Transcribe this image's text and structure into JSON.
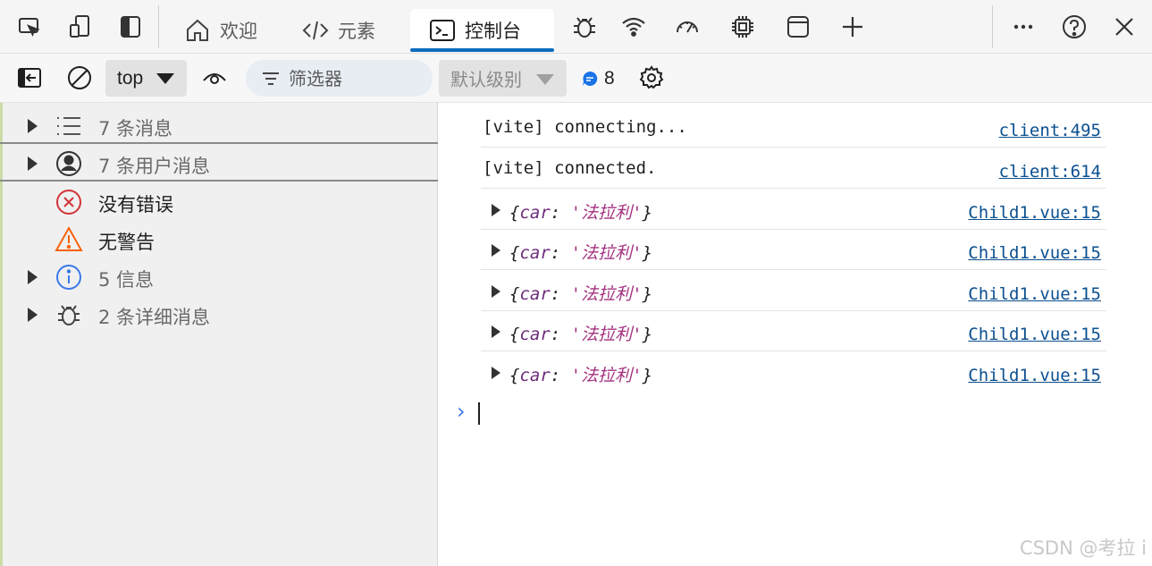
{
  "tabbar": {
    "tabs": [
      {
        "label": "欢迎",
        "icon": "home-icon"
      },
      {
        "label": "元素",
        "icon": "code-icon"
      },
      {
        "label": "控制台",
        "icon": "console-icon",
        "active": true
      }
    ],
    "icons": [
      "device-inspect-icon",
      "device-emulation-icon",
      "dock-sidebar-icon",
      "bug-icon",
      "wifi-icon",
      "performance-gauge-icon",
      "cpu-chip-icon",
      "application-window-icon",
      "plus-icon",
      "more-icon",
      "help-icon",
      "close-icon"
    ]
  },
  "toolbar": {
    "context": "top",
    "filter_placeholder": "筛选器",
    "level": "默认级别",
    "issue_count": "8"
  },
  "sidebar": {
    "items": [
      {
        "label": "7 条消息",
        "icon": "list-icon",
        "expandable": true
      },
      {
        "label": "7 条用户消息",
        "icon": "user-circle-icon",
        "expandable": true
      },
      {
        "label": "没有错误",
        "icon": "error-icon",
        "expandable": false
      },
      {
        "label": "无警告",
        "icon": "warning-icon",
        "expandable": false
      },
      {
        "label": "5 信息",
        "icon": "info-icon",
        "expandable": true
      },
      {
        "label": "2 条详细消息",
        "icon": "bug-icon",
        "expandable": true
      }
    ]
  },
  "console": {
    "messages": [
      {
        "text": "[vite] connecting...",
        "source": "client:495"
      },
      {
        "text": "[vite] connected.",
        "source": "client:614"
      }
    ],
    "objects": [
      {
        "key": "car",
        "value": "'法拉利'",
        "source": "Child1.vue:15"
      },
      {
        "key": "car",
        "value": "'法拉利'",
        "source": "Child1.vue:15"
      },
      {
        "key": "car",
        "value": "'法拉利'",
        "source": "Child1.vue:15"
      },
      {
        "key": "car",
        "value": "'法拉利'",
        "source": "Child1.vue:15"
      },
      {
        "key": "car",
        "value": "'法拉利'",
        "source": "Child1.vue:15"
      }
    ],
    "prompt": "›"
  },
  "watermark": "CSDN @考拉 i",
  "colors": {
    "accent": "#0f6cbd",
    "link": "#0b4f8f",
    "error": "#d13438",
    "warning": "#f7630c",
    "info": "#3b78e7"
  }
}
